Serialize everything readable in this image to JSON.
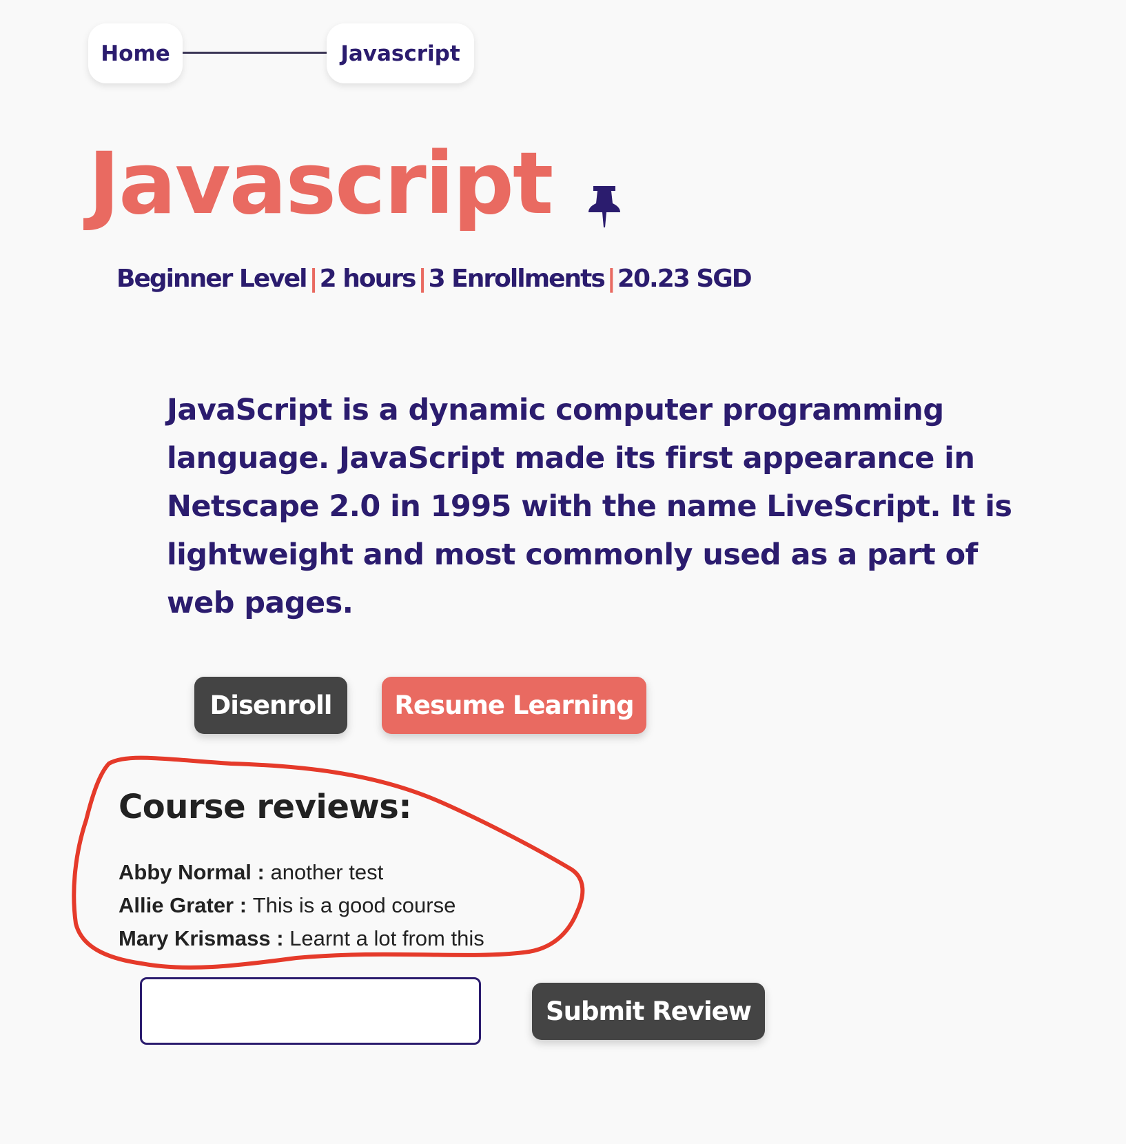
{
  "breadcrumb": {
    "home": "Home",
    "current": "Javascript"
  },
  "course": {
    "title": "Javascript",
    "pin_icon": "pin-icon",
    "level": "Beginner Level",
    "duration": "2 hours",
    "enrollments": "3 Enrollments",
    "price": "20.23 SGD",
    "separator": "|",
    "description": "JavaScript is a dynamic computer programming language. JavaScript made its first appearance in Netscape 2.0 in 1995 with the name LiveScript. It is lightweight and most commonly used as a part of web pages."
  },
  "actions": {
    "disenroll": "Disenroll",
    "resume": "Resume Learning"
  },
  "reviews": {
    "title": "Course reviews:",
    "separator": " : ",
    "items": [
      {
        "name": "Abby Normal",
        "text": "another test"
      },
      {
        "name": "Allie Grater",
        "text": "This is a good course"
      },
      {
        "name": "Mary Krismass",
        "text": "Learnt a lot from this"
      }
    ],
    "input_value": "",
    "submit": "Submit Review"
  },
  "colors": {
    "primary": "#2b1c6e",
    "accent": "#e96a61",
    "dark_button": "#444444",
    "annotation": "#e53a2a",
    "background": "#f9f9f9"
  }
}
